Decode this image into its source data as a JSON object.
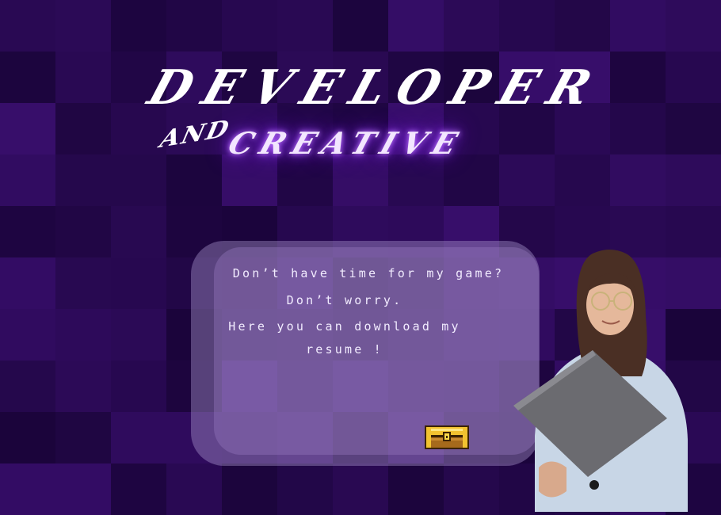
{
  "hero": {
    "title_top": "DEVELOPER",
    "title_and": "AND",
    "title_bottom": "CREATIVE"
  },
  "card": {
    "line1": "Don’t have time for my game?",
    "line2": "Don’t worry.",
    "line3": "Here you can download my",
    "line4": "resume !"
  },
  "icons": {
    "resume_download": "treasure-chest-icon",
    "portrait": "person-with-laptop"
  },
  "colors": {
    "background": "#2a0a4e",
    "glow": "#9b3cff",
    "chest_gold": "#f2c230",
    "chest_wood": "#a66a1c"
  }
}
